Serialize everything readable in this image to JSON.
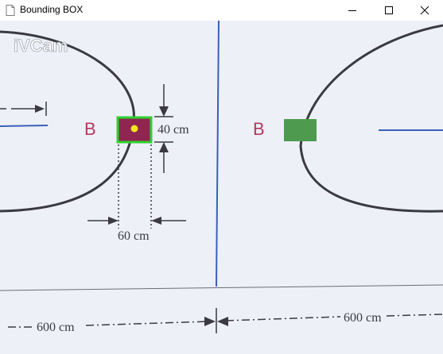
{
  "window": {
    "title": "Bounding BOX",
    "controls": {
      "minimize": "minimize",
      "maximize": "maximize",
      "close": "close"
    }
  },
  "feed": {
    "watermark": "iVCam",
    "labels": {
      "left_zone": "B",
      "right_zone": "B",
      "height_dim": "40 cm",
      "width_dim": "60 cm",
      "bottom_left_dim": "600 cm",
      "bottom_right_dim": "600 cm"
    },
    "colors": {
      "paper": "#eef0f8",
      "line": "#3a3a40",
      "blue_line": "#3a5fb8",
      "target_box": "#8f2652",
      "detection_box": "#2fd12f",
      "center_point": "#f5e51c",
      "right_marker": "#4e9a4e",
      "zone_letter": "#b03a5a"
    }
  }
}
